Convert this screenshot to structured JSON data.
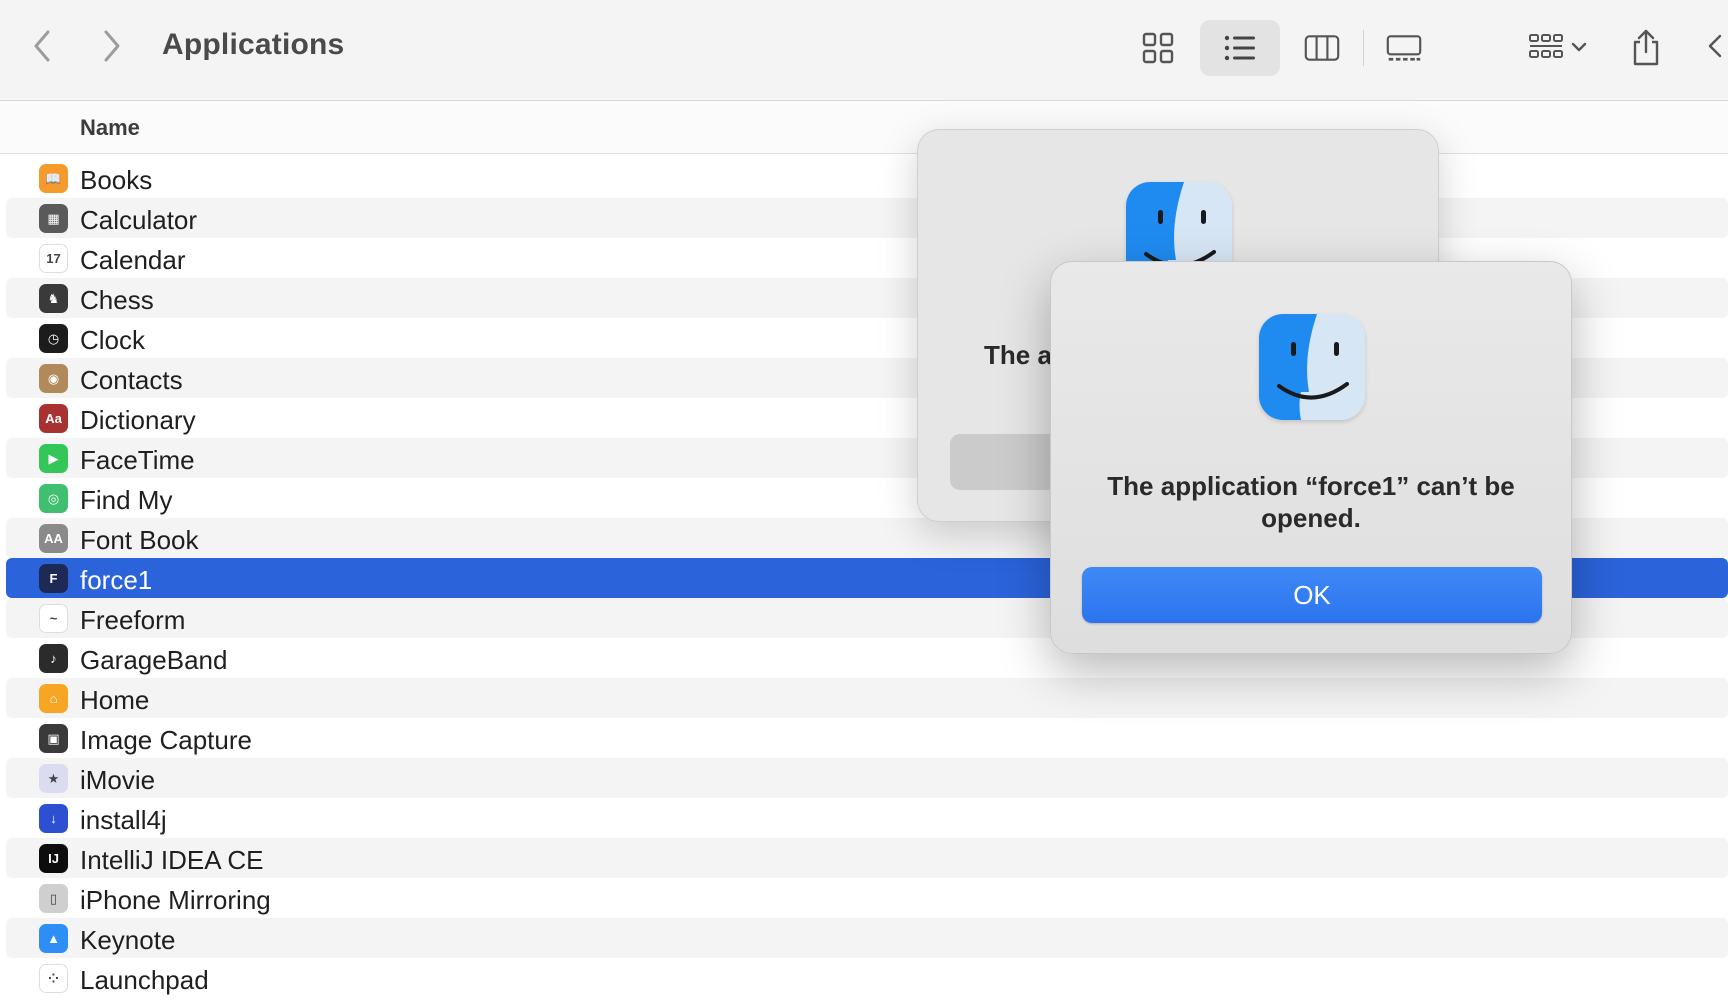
{
  "toolbar": {
    "title": "Applications",
    "back_icon": "chevron-left-icon",
    "forward_icon": "chevron-right-icon",
    "views": [
      "icon-view",
      "list-view",
      "column-view",
      "gallery-view"
    ],
    "active_view": "list-view"
  },
  "header": {
    "name_column": "Name"
  },
  "files": [
    {
      "label": "Books",
      "color": "#f59b2b",
      "glyph": "📖"
    },
    {
      "label": "Calculator",
      "color": "#5a5a5a",
      "glyph": "▦"
    },
    {
      "label": "Calendar",
      "color": "#ffffff",
      "glyph": "17"
    },
    {
      "label": "Chess",
      "color": "#3a3a3a",
      "glyph": "♞"
    },
    {
      "label": "Clock",
      "color": "#1c1c1c",
      "glyph": "◷"
    },
    {
      "label": "Contacts",
      "color": "#b08a5a",
      "glyph": "◉"
    },
    {
      "label": "Dictionary",
      "color": "#a83232",
      "glyph": "Aa"
    },
    {
      "label": "FaceTime",
      "color": "#33c759",
      "glyph": "▶"
    },
    {
      "label": "Find My",
      "color": "#3fbf6f",
      "glyph": "◎"
    },
    {
      "label": "Font Book",
      "color": "#8a8a8a",
      "glyph": "AA"
    },
    {
      "label": "force1",
      "color": "#1e2a55",
      "glyph": "F"
    },
    {
      "label": "Freeform",
      "color": "#ffffff",
      "glyph": "~"
    },
    {
      "label": "GarageBand",
      "color": "#2b2b2b",
      "glyph": "♪"
    },
    {
      "label": "Home",
      "color": "#f6a623",
      "glyph": "⌂"
    },
    {
      "label": "Image Capture",
      "color": "#3a3a3a",
      "glyph": "▣"
    },
    {
      "label": "iMovie",
      "color": "#dcdcf0",
      "glyph": "★"
    },
    {
      "label": "install4j",
      "color": "#2d4fd1",
      "glyph": "↓"
    },
    {
      "label": "IntelliJ IDEA CE",
      "color": "#0d0d0d",
      "glyph": "IJ"
    },
    {
      "label": "iPhone Mirroring",
      "color": "#cfcfcf",
      "glyph": "▯"
    },
    {
      "label": "Keynote",
      "color": "#2f8ef5",
      "glyph": "▲"
    },
    {
      "label": "Launchpad",
      "color": "#ffffff",
      "glyph": "⁘"
    }
  ],
  "selected_file": "force1",
  "dialog_back": {
    "text": "The a"
  },
  "dialog_front": {
    "message": "The application “force1” can’t be opened.",
    "ok_label": "OK"
  },
  "colors": {
    "selection": "#2b63db",
    "ok_button": "#2c74ef",
    "finder_blue": "#1f8bf0",
    "finder_light": "#d7e6f5"
  }
}
